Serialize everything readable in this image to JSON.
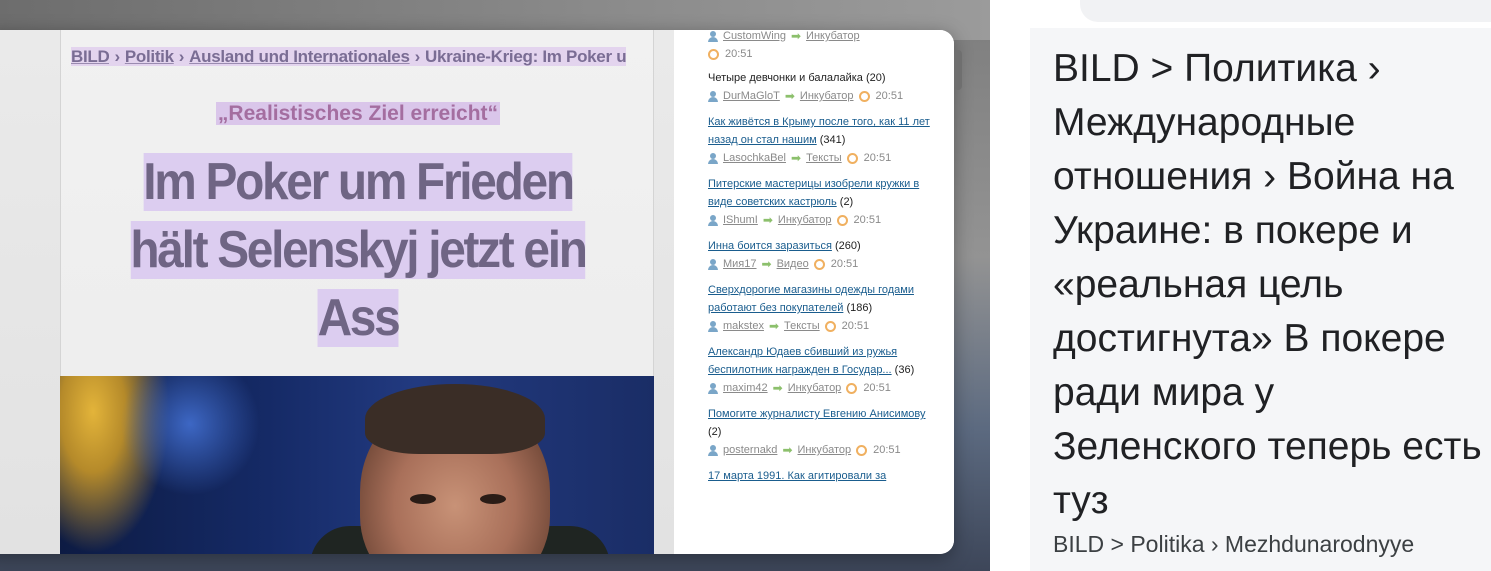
{
  "article": {
    "breadcrumb": [
      {
        "label": "BILD"
      },
      {
        "label": "Politik"
      },
      {
        "label": "Ausland und Internationales"
      }
    ],
    "breadcrumb_current": "Ukraine-Krieg: Im Poker u",
    "breadcrumb_separator": "›",
    "kicker": "„Realistisches Ziel erreicht“",
    "headline_lines": [
      "Im Poker um Frieden",
      "hält Selenskyj jetzt ein",
      "Ass"
    ]
  },
  "news": {
    "items": [
      {
        "title": "",
        "count": "",
        "user": "CustomWing",
        "section": "Инкубатор",
        "time": "20:51"
      },
      {
        "title": "Четыре девчонки и балалайка",
        "count": "(20)",
        "user": "DurMaGloT",
        "section": "Инкубатор",
        "time": "20:51"
      },
      {
        "title": "Как живётся в Крыму после того, как 11 лет назад он стал нашим",
        "count": "(341)",
        "user": "LasochkaBel",
        "section": "Тексты",
        "time": "20:51"
      },
      {
        "title": "Питерские мастерицы изобрели кружки в виде советских кастрюль",
        "count": "(2)",
        "user": "IShumI",
        "section": "Инкубатор",
        "time": "20:51"
      },
      {
        "title": "Инна боится заразиться",
        "count": "(260)",
        "user": "Мия17",
        "section": "Видео",
        "time": "20:51"
      },
      {
        "title": "Сверхдорогие магазины одежды годами работают без покупателей",
        "count": "(186)",
        "user": "makstex",
        "section": "Тексты",
        "time": "20:51"
      },
      {
        "title": "Александр Юдаев сбивший из ружья беспилотник награжден в Государ...",
        "count": "(36)",
        "user": "maxim42",
        "section": "Инкубатор",
        "time": "20:51"
      },
      {
        "title": "Помогите журналисту Евгению Анисимову",
        "count": "(2)",
        "user": "posternakd",
        "section": "Инкубатор",
        "time": "20:51"
      },
      {
        "title": "17 марта 1991. Как агитировали за",
        "count": "",
        "user": "",
        "section": "",
        "time": ""
      }
    ]
  },
  "translation": {
    "text": "BILD > Политика › Международные отношения › Война на Украине: в покере и «реальная цель достигнута» В покере ради мира у Зеленского теперь есть туз",
    "transliteration": "BILD > Politika › Mezhdunarodnyye"
  },
  "colors": {
    "highlight": "#dccdf0",
    "link": "#1a5d8e",
    "accent_green": "#8cc06c",
    "accent_orange": "#f0b060"
  }
}
